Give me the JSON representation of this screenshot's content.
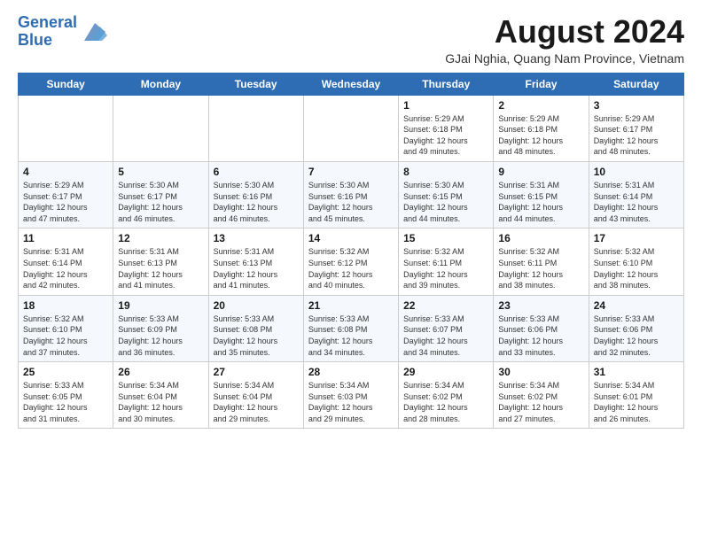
{
  "header": {
    "logo_line1": "General",
    "logo_line2": "Blue",
    "month_year": "August 2024",
    "location": "GJai Nghia, Quang Nam Province, Vietnam"
  },
  "days_of_week": [
    "Sunday",
    "Monday",
    "Tuesday",
    "Wednesday",
    "Thursday",
    "Friday",
    "Saturday"
  ],
  "weeks": [
    [
      {
        "day": "",
        "info": ""
      },
      {
        "day": "",
        "info": ""
      },
      {
        "day": "",
        "info": ""
      },
      {
        "day": "",
        "info": ""
      },
      {
        "day": "1",
        "info": "Sunrise: 5:29 AM\nSunset: 6:18 PM\nDaylight: 12 hours\nand 49 minutes."
      },
      {
        "day": "2",
        "info": "Sunrise: 5:29 AM\nSunset: 6:18 PM\nDaylight: 12 hours\nand 48 minutes."
      },
      {
        "day": "3",
        "info": "Sunrise: 5:29 AM\nSunset: 6:17 PM\nDaylight: 12 hours\nand 48 minutes."
      }
    ],
    [
      {
        "day": "4",
        "info": "Sunrise: 5:29 AM\nSunset: 6:17 PM\nDaylight: 12 hours\nand 47 minutes."
      },
      {
        "day": "5",
        "info": "Sunrise: 5:30 AM\nSunset: 6:17 PM\nDaylight: 12 hours\nand 46 minutes."
      },
      {
        "day": "6",
        "info": "Sunrise: 5:30 AM\nSunset: 6:16 PM\nDaylight: 12 hours\nand 46 minutes."
      },
      {
        "day": "7",
        "info": "Sunrise: 5:30 AM\nSunset: 6:16 PM\nDaylight: 12 hours\nand 45 minutes."
      },
      {
        "day": "8",
        "info": "Sunrise: 5:30 AM\nSunset: 6:15 PM\nDaylight: 12 hours\nand 44 minutes."
      },
      {
        "day": "9",
        "info": "Sunrise: 5:31 AM\nSunset: 6:15 PM\nDaylight: 12 hours\nand 44 minutes."
      },
      {
        "day": "10",
        "info": "Sunrise: 5:31 AM\nSunset: 6:14 PM\nDaylight: 12 hours\nand 43 minutes."
      }
    ],
    [
      {
        "day": "11",
        "info": "Sunrise: 5:31 AM\nSunset: 6:14 PM\nDaylight: 12 hours\nand 42 minutes."
      },
      {
        "day": "12",
        "info": "Sunrise: 5:31 AM\nSunset: 6:13 PM\nDaylight: 12 hours\nand 41 minutes."
      },
      {
        "day": "13",
        "info": "Sunrise: 5:31 AM\nSunset: 6:13 PM\nDaylight: 12 hours\nand 41 minutes."
      },
      {
        "day": "14",
        "info": "Sunrise: 5:32 AM\nSunset: 6:12 PM\nDaylight: 12 hours\nand 40 minutes."
      },
      {
        "day": "15",
        "info": "Sunrise: 5:32 AM\nSunset: 6:11 PM\nDaylight: 12 hours\nand 39 minutes."
      },
      {
        "day": "16",
        "info": "Sunrise: 5:32 AM\nSunset: 6:11 PM\nDaylight: 12 hours\nand 38 minutes."
      },
      {
        "day": "17",
        "info": "Sunrise: 5:32 AM\nSunset: 6:10 PM\nDaylight: 12 hours\nand 38 minutes."
      }
    ],
    [
      {
        "day": "18",
        "info": "Sunrise: 5:32 AM\nSunset: 6:10 PM\nDaylight: 12 hours\nand 37 minutes."
      },
      {
        "day": "19",
        "info": "Sunrise: 5:33 AM\nSunset: 6:09 PM\nDaylight: 12 hours\nand 36 minutes."
      },
      {
        "day": "20",
        "info": "Sunrise: 5:33 AM\nSunset: 6:08 PM\nDaylight: 12 hours\nand 35 minutes."
      },
      {
        "day": "21",
        "info": "Sunrise: 5:33 AM\nSunset: 6:08 PM\nDaylight: 12 hours\nand 34 minutes."
      },
      {
        "day": "22",
        "info": "Sunrise: 5:33 AM\nSunset: 6:07 PM\nDaylight: 12 hours\nand 34 minutes."
      },
      {
        "day": "23",
        "info": "Sunrise: 5:33 AM\nSunset: 6:06 PM\nDaylight: 12 hours\nand 33 minutes."
      },
      {
        "day": "24",
        "info": "Sunrise: 5:33 AM\nSunset: 6:06 PM\nDaylight: 12 hours\nand 32 minutes."
      }
    ],
    [
      {
        "day": "25",
        "info": "Sunrise: 5:33 AM\nSunset: 6:05 PM\nDaylight: 12 hours\nand 31 minutes."
      },
      {
        "day": "26",
        "info": "Sunrise: 5:34 AM\nSunset: 6:04 PM\nDaylight: 12 hours\nand 30 minutes."
      },
      {
        "day": "27",
        "info": "Sunrise: 5:34 AM\nSunset: 6:04 PM\nDaylight: 12 hours\nand 29 minutes."
      },
      {
        "day": "28",
        "info": "Sunrise: 5:34 AM\nSunset: 6:03 PM\nDaylight: 12 hours\nand 29 minutes."
      },
      {
        "day": "29",
        "info": "Sunrise: 5:34 AM\nSunset: 6:02 PM\nDaylight: 12 hours\nand 28 minutes."
      },
      {
        "day": "30",
        "info": "Sunrise: 5:34 AM\nSunset: 6:02 PM\nDaylight: 12 hours\nand 27 minutes."
      },
      {
        "day": "31",
        "info": "Sunrise: 5:34 AM\nSunset: 6:01 PM\nDaylight: 12 hours\nand 26 minutes."
      }
    ]
  ]
}
